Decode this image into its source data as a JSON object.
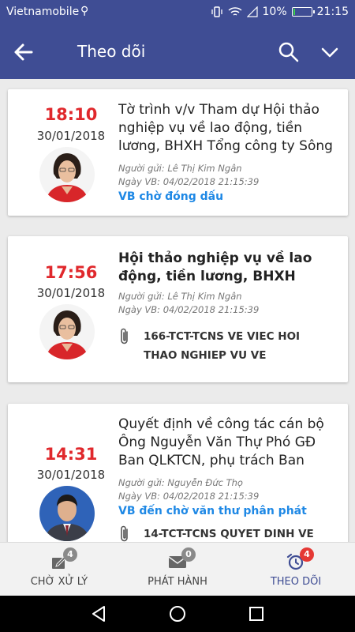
{
  "status_bar": {
    "carrier": "Vietnamobile",
    "battery": "10%",
    "time": "21:15",
    "battery_level": 0.1
  },
  "app_bar": {
    "title": "Theo dõi"
  },
  "documents": [
    {
      "time": "18:10",
      "date": "30/01/2018",
      "subject": "Tờ trình v/v Tham dự Hội thảo nghiệp vụ về lao động, tiền lương, BHXH Tổng công ty Sông Đà nă…",
      "sender": "Người gửi: Lê Thị Kim Ngân",
      "doc_date": "Ngày VB: 04/02/2018 21:15:39",
      "status": "VB chờ đóng dấu"
    },
    {
      "time": "17:56",
      "date": "30/01/2018",
      "subject": "Hội thảo nghiệp vụ về lao động, tiền lương, BHXH",
      "sender": "Người gửi: Lê Thị Kim Ngân",
      "doc_date": "Ngày VB: 04/02/2018 21:15:39",
      "attachment": "166-TCT-TCNS VE VIEC HOI THAO NGHIEP VU VE"
    },
    {
      "time": "14:31",
      "date": "30/01/2018",
      "subject": "Quyết định về công tác cán bộ Ông Nguyễn Văn Thự Phó GĐ Ban QLKTCN, phụ trách Ban QLKTCN…",
      "sender": "Người gửi: Nguyễn Đức Thọ",
      "doc_date": "Ngày VB: 04/02/2018 21:15:39",
      "status": "VB đến chờ văn thư phân phát",
      "attachment": "14-TCT-TCNS QUYET DINH VE"
    }
  ],
  "bottom_nav": [
    {
      "label": "CHỜ XỬ LÝ",
      "badge": "4",
      "icon": "edit-icon"
    },
    {
      "label": "PHÁT HÀNH",
      "badge": "0",
      "icon": "mail-icon"
    },
    {
      "label": "THEO DÕI",
      "badge": "4",
      "icon": "alarm-clock-icon"
    }
  ],
  "colors": {
    "primary": "#3f4d94",
    "time_red": "#e0282c",
    "status_blue": "#1e88e5",
    "badge_grey": "#8a8a8a",
    "badge_red": "#e53935"
  }
}
